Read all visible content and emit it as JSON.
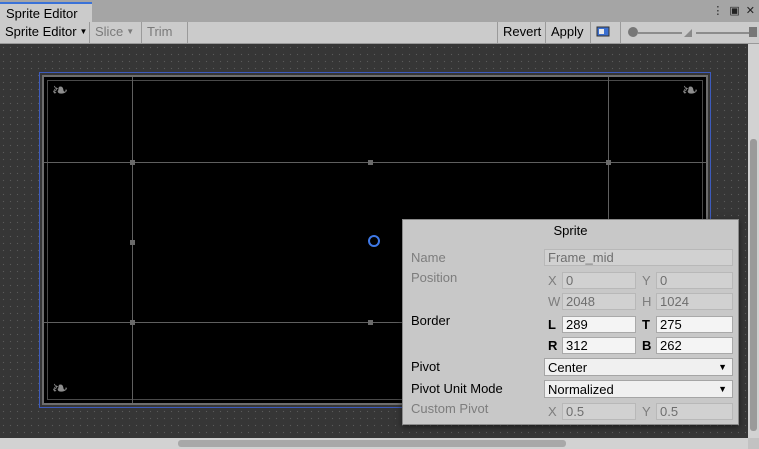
{
  "tab": {
    "title": "Sprite Editor",
    "menu_icon": "kebab-menu-icon",
    "maximize_icon": "maximize-icon",
    "close_icon": "close-icon"
  },
  "toolbar": {
    "mode": "Sprite Editor",
    "slice": "Slice",
    "trim": "Trim",
    "revert": "Revert",
    "apply": "Apply",
    "color_toggle_icon": "rgb-toggle-icon",
    "zoom_icon": "zoom-slider-icon",
    "mip_icon": "mip-level-icon"
  },
  "panel": {
    "title": "Sprite",
    "name_label": "Name",
    "name_value": "Frame_mid",
    "position_label": "Position",
    "x_axis": "X",
    "x_value": "0",
    "y_axis": "Y",
    "y_value": "0",
    "w_axis": "W",
    "w_value": "2048",
    "h_axis": "H",
    "h_value": "1024",
    "border_label": "Border",
    "l_axis": "L",
    "l_value": "289",
    "t_axis": "T",
    "t_value": "275",
    "r_axis": "R",
    "r_value": "312",
    "b_axis": "B",
    "b_value": "262",
    "pivot_label": "Pivot",
    "pivot_value": "Center",
    "pivot_unit_label": "Pivot Unit Mode",
    "pivot_unit_value": "Normalized",
    "custom_pivot_label": "Custom Pivot",
    "cx_axis": "X",
    "cx_value": "0.5",
    "cy_axis": "Y",
    "cy_value": "0.5"
  },
  "colors": {
    "selection_outline": "#3d5bbd",
    "pivot_ring": "#3e78e6",
    "tab_accent": "#3a72d8"
  }
}
